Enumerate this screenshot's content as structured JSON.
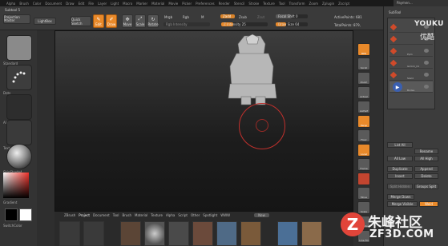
{
  "menubar": [
    "Alpha",
    "Brush",
    "Color",
    "Document",
    "Draw",
    "Edit",
    "File",
    "Layer",
    "Light",
    "Macro",
    "Marker",
    "Material",
    "Movie",
    "Picker",
    "Preferences",
    "Render",
    "Stencil",
    "Stroke",
    "Texture",
    "Tool",
    "Transform",
    "Zoom",
    "Zplugin",
    "Zscript"
  ],
  "menubar_right": "Paymen...",
  "topshelf": {
    "subtool_label": "Subtool 5",
    "projection_master": "Projection Master",
    "lightbox": "LightBox",
    "quick_sketch": "Quick Sketch",
    "edit": "Edit",
    "draw": "Draw",
    "move": "Move",
    "scale": "Scale",
    "rotate": "Rotate",
    "mrgb": "Mrgb",
    "rgb": "Rgb",
    "m": "M",
    "rgb_intensity": "Rgb Intensity",
    "zadd": "Zadd",
    "zsub": "Zsub",
    "zcut": "Zcut",
    "z_intensity": "Z Intensity 25",
    "focal_shift": "Focal Shift 0",
    "draw_size": "Draw Size 64",
    "active_points": "ActivePoints: 681",
    "total_points": "TotalPoints: 879,"
  },
  "left": {
    "thumbs": [
      "Standard",
      "Dots",
      "",
      "Alpha Off",
      "Texture Off",
      "SkinShade4"
    ],
    "gradient": "Gradient",
    "switch_color": "SwitchColor"
  },
  "right_shelf": [
    "BPR",
    "Scroll",
    "Zoom",
    "Actual",
    "AAHalf",
    "Persp",
    "Floor",
    "Local",
    "Frame",
    "Move",
    "Scale",
    "Rotate",
    "Line Fill",
    "Transp",
    "Solo",
    "Xpose"
  ],
  "subtool": {
    "header": "SubTool",
    "rows": [
      "",
      "",
      "Ppm",
      "Gmkm_01",
      "Sksld",
      "Bodes"
    ],
    "list_all": "List All",
    "rename": "Rename",
    "all_low": "All Low",
    "all_high": "All High",
    "duplicate": "Duplicate",
    "append": "Append",
    "insert": "Insert",
    "delete": "Delete",
    "split_hidden": "Split Hidden",
    "groups_split": "Groups Split",
    "merge_down": "Merge Down",
    "merge_visible": "Merge Visible",
    "weld": "Weld"
  },
  "bottom_tabs": [
    "ZBrush",
    "Project",
    "Document",
    "Tool",
    "Brush",
    "Material",
    "Texture",
    "Alpha",
    "Script",
    "Other",
    "Spotlight",
    "WWW"
  ],
  "bottom_active": "Project",
  "bottom_new": "New",
  "logo": {
    "line1": "YOUKU",
    "line2": "优酷"
  },
  "watermark": {
    "z": "Z",
    "cn": "朱峰社区",
    "url": "ZF3D.COM"
  }
}
